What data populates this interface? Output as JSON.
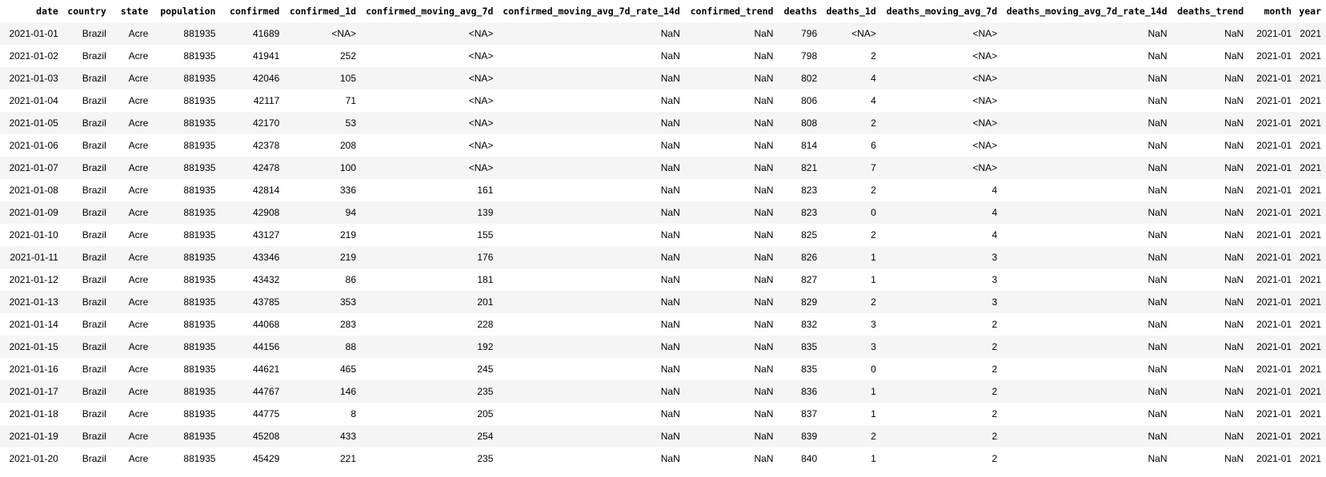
{
  "columns": [
    "date",
    "country",
    "state",
    "population",
    "confirmed",
    "confirmed_1d",
    "confirmed_moving_avg_7d",
    "confirmed_moving_avg_7d_rate_14d",
    "confirmed_trend",
    "deaths",
    "deaths_1d",
    "deaths_moving_avg_7d",
    "deaths_moving_avg_7d_rate_14d",
    "deaths_trend",
    "month",
    "year"
  ],
  "rows": [
    [
      "2021-01-01",
      "Brazil",
      "Acre",
      "881935",
      "41689",
      "<NA>",
      "<NA>",
      "NaN",
      "NaN",
      "796",
      "<NA>",
      "<NA>",
      "NaN",
      "NaN",
      "2021-01",
      "2021"
    ],
    [
      "2021-01-02",
      "Brazil",
      "Acre",
      "881935",
      "41941",
      "252",
      "<NA>",
      "NaN",
      "NaN",
      "798",
      "2",
      "<NA>",
      "NaN",
      "NaN",
      "2021-01",
      "2021"
    ],
    [
      "2021-01-03",
      "Brazil",
      "Acre",
      "881935",
      "42046",
      "105",
      "<NA>",
      "NaN",
      "NaN",
      "802",
      "4",
      "<NA>",
      "NaN",
      "NaN",
      "2021-01",
      "2021"
    ],
    [
      "2021-01-04",
      "Brazil",
      "Acre",
      "881935",
      "42117",
      "71",
      "<NA>",
      "NaN",
      "NaN",
      "806",
      "4",
      "<NA>",
      "NaN",
      "NaN",
      "2021-01",
      "2021"
    ],
    [
      "2021-01-05",
      "Brazil",
      "Acre",
      "881935",
      "42170",
      "53",
      "<NA>",
      "NaN",
      "NaN",
      "808",
      "2",
      "<NA>",
      "NaN",
      "NaN",
      "2021-01",
      "2021"
    ],
    [
      "2021-01-06",
      "Brazil",
      "Acre",
      "881935",
      "42378",
      "208",
      "<NA>",
      "NaN",
      "NaN",
      "814",
      "6",
      "<NA>",
      "NaN",
      "NaN",
      "2021-01",
      "2021"
    ],
    [
      "2021-01-07",
      "Brazil",
      "Acre",
      "881935",
      "42478",
      "100",
      "<NA>",
      "NaN",
      "NaN",
      "821",
      "7",
      "<NA>",
      "NaN",
      "NaN",
      "2021-01",
      "2021"
    ],
    [
      "2021-01-08",
      "Brazil",
      "Acre",
      "881935",
      "42814",
      "336",
      "161",
      "NaN",
      "NaN",
      "823",
      "2",
      "4",
      "NaN",
      "NaN",
      "2021-01",
      "2021"
    ],
    [
      "2021-01-09",
      "Brazil",
      "Acre",
      "881935",
      "42908",
      "94",
      "139",
      "NaN",
      "NaN",
      "823",
      "0",
      "4",
      "NaN",
      "NaN",
      "2021-01",
      "2021"
    ],
    [
      "2021-01-10",
      "Brazil",
      "Acre",
      "881935",
      "43127",
      "219",
      "155",
      "NaN",
      "NaN",
      "825",
      "2",
      "4",
      "NaN",
      "NaN",
      "2021-01",
      "2021"
    ],
    [
      "2021-01-11",
      "Brazil",
      "Acre",
      "881935",
      "43346",
      "219",
      "176",
      "NaN",
      "NaN",
      "826",
      "1",
      "3",
      "NaN",
      "NaN",
      "2021-01",
      "2021"
    ],
    [
      "2021-01-12",
      "Brazil",
      "Acre",
      "881935",
      "43432",
      "86",
      "181",
      "NaN",
      "NaN",
      "827",
      "1",
      "3",
      "NaN",
      "NaN",
      "2021-01",
      "2021"
    ],
    [
      "2021-01-13",
      "Brazil",
      "Acre",
      "881935",
      "43785",
      "353",
      "201",
      "NaN",
      "NaN",
      "829",
      "2",
      "3",
      "NaN",
      "NaN",
      "2021-01",
      "2021"
    ],
    [
      "2021-01-14",
      "Brazil",
      "Acre",
      "881935",
      "44068",
      "283",
      "228",
      "NaN",
      "NaN",
      "832",
      "3",
      "2",
      "NaN",
      "NaN",
      "2021-01",
      "2021"
    ],
    [
      "2021-01-15",
      "Brazil",
      "Acre",
      "881935",
      "44156",
      "88",
      "192",
      "NaN",
      "NaN",
      "835",
      "3",
      "2",
      "NaN",
      "NaN",
      "2021-01",
      "2021"
    ],
    [
      "2021-01-16",
      "Brazil",
      "Acre",
      "881935",
      "44621",
      "465",
      "245",
      "NaN",
      "NaN",
      "835",
      "0",
      "2",
      "NaN",
      "NaN",
      "2021-01",
      "2021"
    ],
    [
      "2021-01-17",
      "Brazil",
      "Acre",
      "881935",
      "44767",
      "146",
      "235",
      "NaN",
      "NaN",
      "836",
      "1",
      "2",
      "NaN",
      "NaN",
      "2021-01",
      "2021"
    ],
    [
      "2021-01-18",
      "Brazil",
      "Acre",
      "881935",
      "44775",
      "8",
      "205",
      "NaN",
      "NaN",
      "837",
      "1",
      "2",
      "NaN",
      "NaN",
      "2021-01",
      "2021"
    ],
    [
      "2021-01-19",
      "Brazil",
      "Acre",
      "881935",
      "45208",
      "433",
      "254",
      "NaN",
      "NaN",
      "839",
      "2",
      "2",
      "NaN",
      "NaN",
      "2021-01",
      "2021"
    ],
    [
      "2021-01-20",
      "Brazil",
      "Acre",
      "881935",
      "45429",
      "221",
      "235",
      "NaN",
      "NaN",
      "840",
      "1",
      "2",
      "NaN",
      "NaN",
      "2021-01",
      "2021"
    ]
  ]
}
